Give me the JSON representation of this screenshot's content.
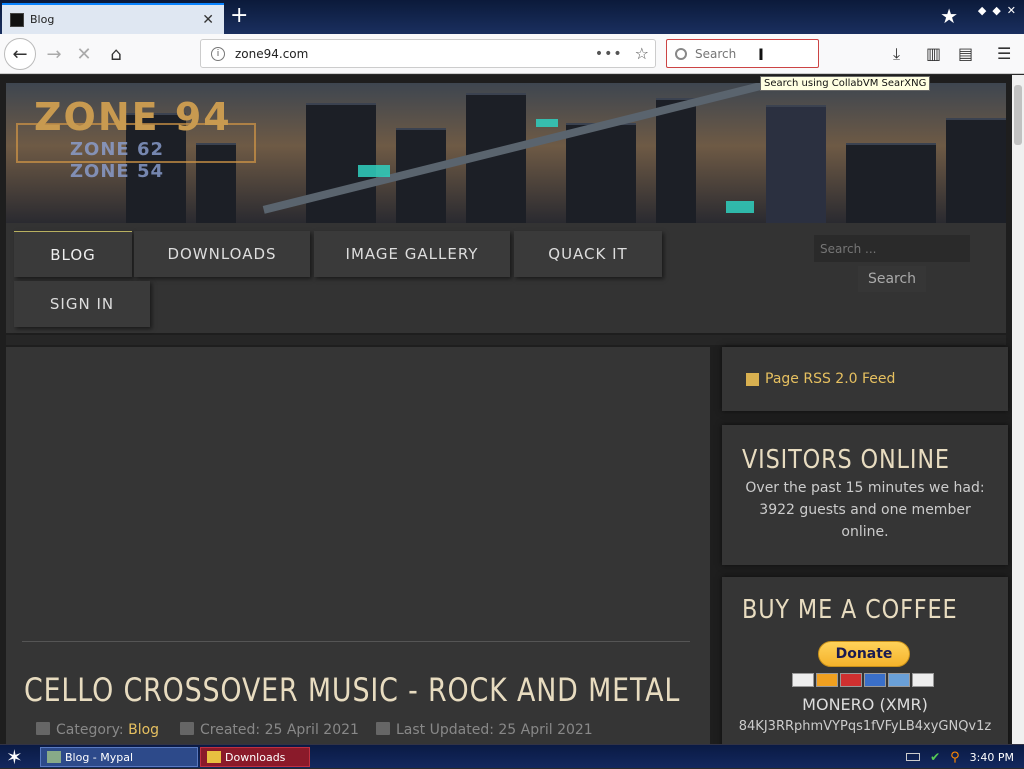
{
  "browser": {
    "tab_title": "Blog",
    "tab_close": "✕",
    "new_tab": "+",
    "url": "zone94.com",
    "url_more": "•••",
    "search_placeholder": "Search",
    "tooltip": "Search using CollabVM SearXNG"
  },
  "header": {
    "logo_main": "ZONE 94",
    "logo_sub1": "ZONE 62",
    "logo_sub2": "ZONE 54"
  },
  "menu": {
    "items": [
      "BLOG",
      "DOWNLOADS",
      "IMAGE GALLERY",
      "QUACK IT",
      "SIGN IN"
    ],
    "search_placeholder": "Search ...",
    "search_button": "Search"
  },
  "article": {
    "title": "CELLO CROSSOVER MUSIC - ROCK AND METAL",
    "category_label": "Category:",
    "category": "Blog",
    "created": "Created: 25 April 2021",
    "updated": "Last Updated: 25 April 2021"
  },
  "sidebar": {
    "rss": "Page RSS 2.0 Feed",
    "visitors_title": "VISITORS ONLINE",
    "visitors_text": "Over the past 15 minutes we had: 3922 guests and one member online.",
    "coffee_title": "BUY ME A COFFEE",
    "donate": "Donate",
    "monero": "MONERO (XMR)",
    "address": "84KJ3RRphmVYPqs1fVFyLB4xyGNQv1z"
  },
  "taskbar": {
    "task1": "Blog - Mypal",
    "task2": "Downloads",
    "clock": "3:40 PM"
  },
  "colors": {
    "accent": "#e6c060",
    "heading": "#e8dcc0",
    "panel": "#353535"
  }
}
